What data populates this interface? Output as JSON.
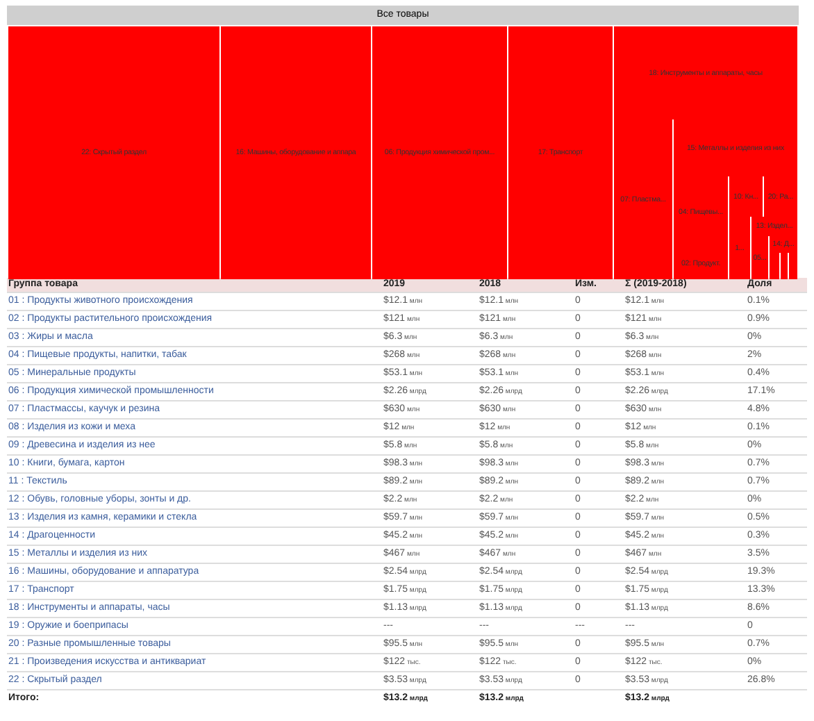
{
  "treemap": {
    "title": "Все товары",
    "tiles": [
      {
        "label": "22: Скрытый раздел"
      },
      {
        "label": "16: Машины, оборудование и аппара"
      },
      {
        "label": "06: Продукция химической пром..."
      },
      {
        "label": "17: Транспорт"
      },
      {
        "label": "18: Инструменты и аппараты, часы"
      },
      {
        "label": "07: Пластма..."
      },
      {
        "label": "15: Металлы и изделия из них"
      },
      {
        "label": "04: Пищевы..."
      },
      {
        "label": "02: Продукт."
      },
      {
        "label": "10: Кн..."
      },
      {
        "label": "20: Ра..."
      },
      {
        "label": "1..."
      },
      {
        "label": "13: Издел..."
      },
      {
        "label": "05..."
      },
      {
        "label": "14: Д..."
      }
    ]
  },
  "table": {
    "columns": [
      "Группа товара",
      "2019",
      "2018",
      "Изм.",
      "Σ (2019-2018)",
      "Доля"
    ],
    "rows": [
      {
        "group": "01 : Продукты животного происхождения",
        "v2019": {
          "amount": "$12.1",
          "unit": "млн"
        },
        "v2018": {
          "amount": "$12.1",
          "unit": "млн"
        },
        "change": "0",
        "sum": {
          "amount": "$12.1",
          "unit": "млн"
        },
        "share": "0.1%"
      },
      {
        "group": "02 : Продукты растительного происхождения",
        "v2019": {
          "amount": "$121",
          "unit": "млн"
        },
        "v2018": {
          "amount": "$121",
          "unit": "млн"
        },
        "change": "0",
        "sum": {
          "amount": "$121",
          "unit": "млн"
        },
        "share": "0.9%"
      },
      {
        "group": "03 : Жиры и масла",
        "v2019": {
          "amount": "$6.3",
          "unit": "млн"
        },
        "v2018": {
          "amount": "$6.3",
          "unit": "млн"
        },
        "change": "0",
        "sum": {
          "amount": "$6.3",
          "unit": "млн"
        },
        "share": "0%"
      },
      {
        "group": "04 : Пищевые продукты, напитки, табак",
        "v2019": {
          "amount": "$268",
          "unit": "млн"
        },
        "v2018": {
          "amount": "$268",
          "unit": "млн"
        },
        "change": "0",
        "sum": {
          "amount": "$268",
          "unit": "млн"
        },
        "share": "2%"
      },
      {
        "group": "05 : Минеральные продукты",
        "v2019": {
          "amount": "$53.1",
          "unit": "млн"
        },
        "v2018": {
          "amount": "$53.1",
          "unit": "млн"
        },
        "change": "0",
        "sum": {
          "amount": "$53.1",
          "unit": "млн"
        },
        "share": "0.4%"
      },
      {
        "group": "06 : Продукция химической промышленности",
        "v2019": {
          "amount": "$2.26",
          "unit": "млрд"
        },
        "v2018": {
          "amount": "$2.26",
          "unit": "млрд"
        },
        "change": "0",
        "sum": {
          "amount": "$2.26",
          "unit": "млрд"
        },
        "share": "17.1%"
      },
      {
        "group": "07 : Пластмассы, каучук и резина",
        "v2019": {
          "amount": "$630",
          "unit": "млн"
        },
        "v2018": {
          "amount": "$630",
          "unit": "млн"
        },
        "change": "0",
        "sum": {
          "amount": "$630",
          "unit": "млн"
        },
        "share": "4.8%"
      },
      {
        "group": "08 : Изделия из кожи и меха",
        "v2019": {
          "amount": "$12",
          "unit": "млн"
        },
        "v2018": {
          "amount": "$12",
          "unit": "млн"
        },
        "change": "0",
        "sum": {
          "amount": "$12",
          "unit": "млн"
        },
        "share": "0.1%"
      },
      {
        "group": "09 : Древесина и изделия из нее",
        "v2019": {
          "amount": "$5.8",
          "unit": "млн"
        },
        "v2018": {
          "amount": "$5.8",
          "unit": "млн"
        },
        "change": "0",
        "sum": {
          "amount": "$5.8",
          "unit": "млн"
        },
        "share": "0%"
      },
      {
        "group": "10 : Книги, бумага, картон",
        "v2019": {
          "amount": "$98.3",
          "unit": "млн"
        },
        "v2018": {
          "amount": "$98.3",
          "unit": "млн"
        },
        "change": "0",
        "sum": {
          "amount": "$98.3",
          "unit": "млн"
        },
        "share": "0.7%"
      },
      {
        "group": "11 : Текстиль",
        "v2019": {
          "amount": "$89.2",
          "unit": "млн"
        },
        "v2018": {
          "amount": "$89.2",
          "unit": "млн"
        },
        "change": "0",
        "sum": {
          "amount": "$89.2",
          "unit": "млн"
        },
        "share": "0.7%"
      },
      {
        "group": "12 : Обувь, головные уборы, зонты и др.",
        "v2019": {
          "amount": "$2.2",
          "unit": "млн"
        },
        "v2018": {
          "amount": "$2.2",
          "unit": "млн"
        },
        "change": "0",
        "sum": {
          "amount": "$2.2",
          "unit": "млн"
        },
        "share": "0%"
      },
      {
        "group": "13 : Изделия из камня, керамики и стекла",
        "v2019": {
          "amount": "$59.7",
          "unit": "млн"
        },
        "v2018": {
          "amount": "$59.7",
          "unit": "млн"
        },
        "change": "0",
        "sum": {
          "amount": "$59.7",
          "unit": "млн"
        },
        "share": "0.5%"
      },
      {
        "group": "14 : Драгоценности",
        "v2019": {
          "amount": "$45.2",
          "unit": "млн"
        },
        "v2018": {
          "amount": "$45.2",
          "unit": "млн"
        },
        "change": "0",
        "sum": {
          "amount": "$45.2",
          "unit": "млн"
        },
        "share": "0.3%"
      },
      {
        "group": "15 : Металлы и изделия из них",
        "v2019": {
          "amount": "$467",
          "unit": "млн"
        },
        "v2018": {
          "amount": "$467",
          "unit": "млн"
        },
        "change": "0",
        "sum": {
          "amount": "$467",
          "unit": "млн"
        },
        "share": "3.5%"
      },
      {
        "group": "16 : Машины, оборудование и аппаратура",
        "v2019": {
          "amount": "$2.54",
          "unit": "млрд"
        },
        "v2018": {
          "amount": "$2.54",
          "unit": "млрд"
        },
        "change": "0",
        "sum": {
          "amount": "$2.54",
          "unit": "млрд"
        },
        "share": "19.3%"
      },
      {
        "group": "17 : Транспорт",
        "v2019": {
          "amount": "$1.75",
          "unit": "млрд"
        },
        "v2018": {
          "amount": "$1.75",
          "unit": "млрд"
        },
        "change": "0",
        "sum": {
          "amount": "$1.75",
          "unit": "млрд"
        },
        "share": "13.3%"
      },
      {
        "group": "18 : Инструменты и аппараты, часы",
        "v2019": {
          "amount": "$1.13",
          "unit": "млрд"
        },
        "v2018": {
          "amount": "$1.13",
          "unit": "млрд"
        },
        "change": "0",
        "sum": {
          "amount": "$1.13",
          "unit": "млрд"
        },
        "share": "8.6%"
      },
      {
        "group": "19 : Оружие и боеприпасы",
        "v2019": {
          "amount": "---"
        },
        "v2018": {
          "amount": "---"
        },
        "change": "---",
        "sum": {
          "amount": "---"
        },
        "share": "0"
      },
      {
        "group": "20 : Разные промышленные товары",
        "v2019": {
          "amount": "$95.5",
          "unit": "млн"
        },
        "v2018": {
          "amount": "$95.5",
          "unit": "млн"
        },
        "change": "0",
        "sum": {
          "amount": "$95.5",
          "unit": "млн"
        },
        "share": "0.7%"
      },
      {
        "group": "21 : Произведения искусства и антиквариат",
        "v2019": {
          "amount": "$122",
          "unit": "тыс."
        },
        "v2018": {
          "amount": "$122",
          "unit": "тыс."
        },
        "change": "0",
        "sum": {
          "amount": "$122",
          "unit": "тыс."
        },
        "share": "0%"
      },
      {
        "group": "22 : Скрытый раздел",
        "v2019": {
          "amount": "$3.53",
          "unit": "млрд"
        },
        "v2018": {
          "amount": "$3.53",
          "unit": "млрд"
        },
        "change": "0",
        "sum": {
          "amount": "$3.53",
          "unit": "млрд"
        },
        "share": "26.8%"
      }
    ],
    "total": {
      "label": "Итого:",
      "v2019": {
        "amount": "$13.2",
        "unit": "млрд"
      },
      "v2018": {
        "amount": "$13.2",
        "unit": "млрд"
      },
      "sum": {
        "amount": "$13.2",
        "unit": "млрд"
      }
    }
  }
}
